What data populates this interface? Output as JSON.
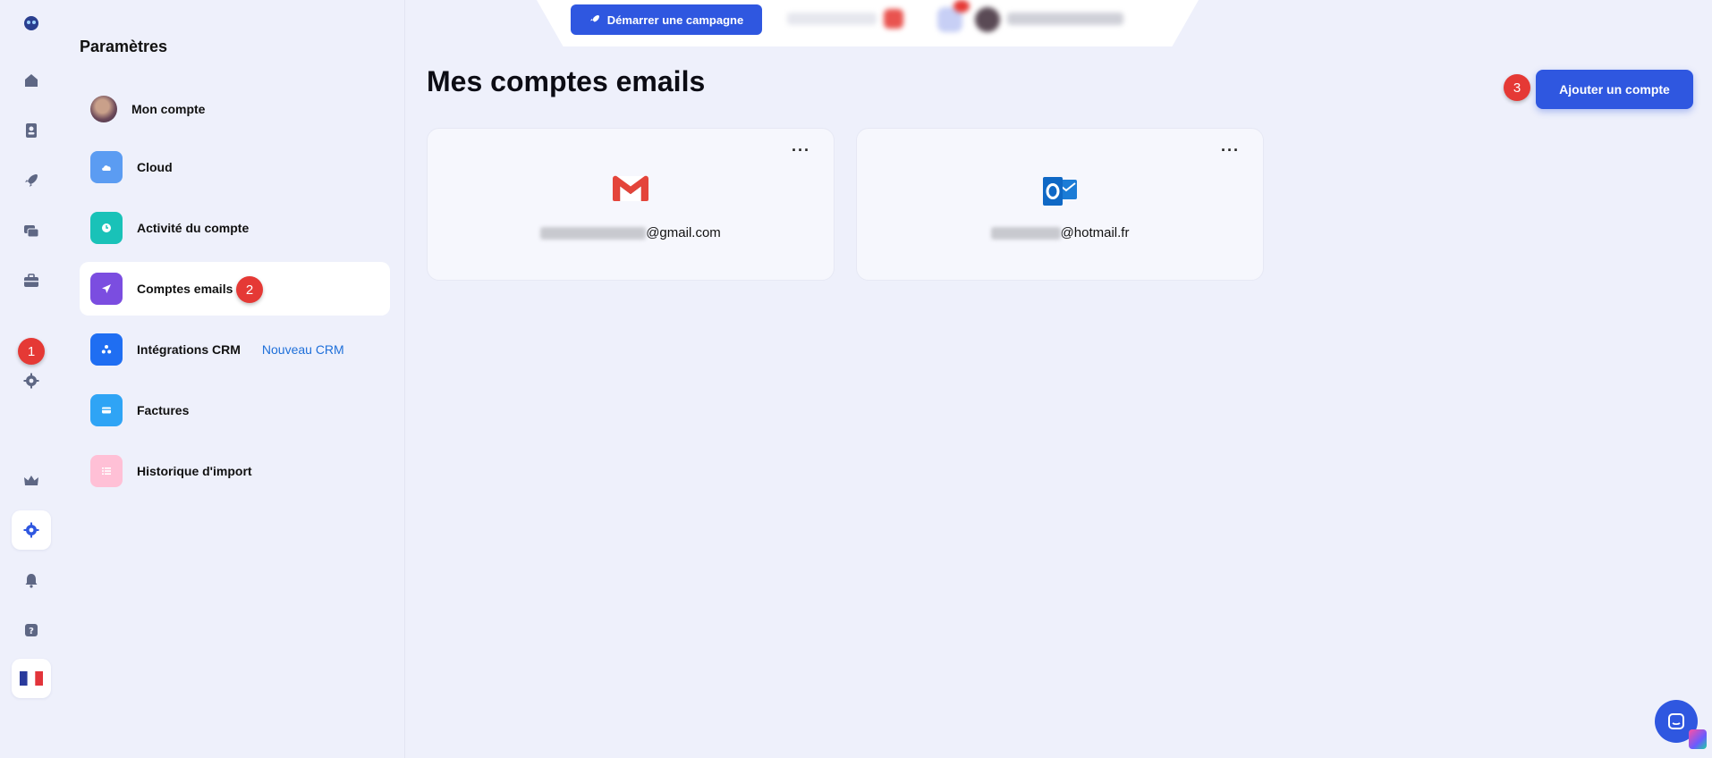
{
  "colors": {
    "accent": "#2f57e0",
    "badge": "#e53935",
    "link": "#1e6fd9",
    "background": "#eef0fb"
  },
  "rail": {
    "icons": [
      "logo-icon",
      "home-icon",
      "contacts-icon",
      "rocket-icon",
      "chat-icon",
      "briefcase-icon",
      "settings-icon",
      "crown-icon",
      "settings-icon",
      "bell-icon",
      "help-icon",
      "flag-fr-icon"
    ]
  },
  "badges": {
    "one": "1",
    "two": "2",
    "three": "3"
  },
  "settings": {
    "title": "Paramètres",
    "items": [
      {
        "label": "Mon compte",
        "icon": "avatar"
      },
      {
        "label": "Cloud",
        "icon": "cloud-icon",
        "color": "#5b9cf2"
      },
      {
        "label": "Activité du compte",
        "icon": "clock-icon",
        "color": "#19c2b8"
      },
      {
        "label": "Comptes emails",
        "icon": "send-icon",
        "color": "#7b4de0"
      },
      {
        "label": "Intégrations CRM",
        "icon": "integration-icon",
        "color": "#1f6ef2",
        "tag": "Nouveau CRM"
      },
      {
        "label": "Factures",
        "icon": "card-icon",
        "color": "#2fa4f5"
      },
      {
        "label": "Historique d'import",
        "icon": "list-icon",
        "color": "#ffc0d6"
      }
    ]
  },
  "topbar": {
    "campaign_label": "Démarrer une campagne"
  },
  "main": {
    "title": "Mes comptes emails",
    "add_label": "Ajouter un compte",
    "accounts": [
      {
        "provider_icon": "gmail-icon",
        "email_suffix": "@gmail.com",
        "menu": "···"
      },
      {
        "provider_icon": "outlook-icon",
        "email_suffix": "@hotmail.fr",
        "menu": "···"
      }
    ]
  }
}
